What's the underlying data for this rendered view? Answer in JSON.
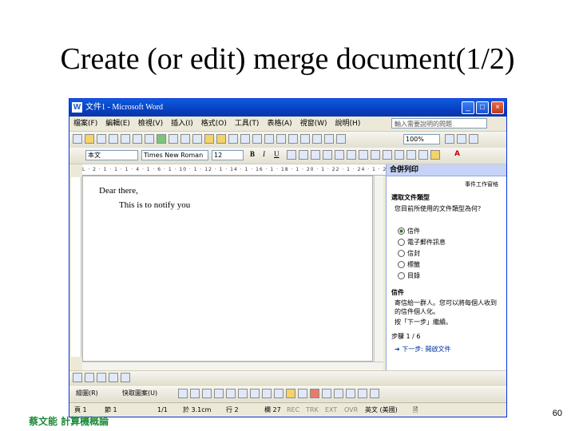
{
  "slide": {
    "title": "Create (or edit) merge document(1/2)",
    "footer": "蔡文能 計算機概論",
    "page_number": "60"
  },
  "window": {
    "title": "文件1 - Microsoft Word",
    "app_icon": "W",
    "minimize": "_",
    "maximize": "□",
    "close": "×"
  },
  "menu": {
    "items": [
      "檔案(F)",
      "編輯(E)",
      "檢視(V)",
      "插入(I)",
      "格式(O)",
      "工具(T)",
      "表格(A)",
      "視窗(W)",
      "說明(H)"
    ],
    "help_placeholder": "輸入需要說明的問題"
  },
  "toolbar": {
    "zoom": "100%",
    "style": "本文",
    "font": "Times New Roman",
    "size": "12",
    "bold": "B",
    "italic": "I",
    "underline": "U",
    "font_color": "A"
  },
  "ruler": {
    "marks": "L  · 2 · 1 · 1 · 1 · 4 · 1 · 6 · 1 · 10 · 1 · 12 · 1 · 14 · 1 · 16 · 1 · 18 · 1 · 20 · 1 · 22 · 1 · 24 · 1 · 26 · 1 · 28 · 1 · 30 · 1 · 32 · 1 · 34 · 1 · 36 · 1 · 38 ·"
  },
  "document": {
    "line1": "Dear there,",
    "line2": "This is to notify you"
  },
  "task_pane": {
    "title": "合併列印",
    "link": "事件工作窗格",
    "section1": "選取文件類型",
    "question": "您目前所使用的文件類型為何?",
    "options": [
      "信件",
      "電子郵件訊息",
      "信封",
      "標籤",
      "目錄"
    ],
    "selected_index": 0,
    "section2": "信件",
    "desc": "寄信給一群人。您可以將每個人收到的信件個人化。",
    "next_hint": "按「下一步」繼續。",
    "step": "步驟 1 / 6",
    "next_link": "下一步: 開啟文件"
  },
  "drawing_bar": {
    "draw_label": "繪圖(R)",
    "autoshapes": "快取圖案(U)"
  },
  "status": {
    "page": "頁 1",
    "section": "節 1",
    "pages": "1/1",
    "at": "於 3.1cm",
    "line": "行 2",
    "col": "欄 27",
    "rec": "REC",
    "trk": "TRK",
    "ext": "EXT",
    "ovr": "OVR",
    "lang": "英文 (美國)"
  }
}
